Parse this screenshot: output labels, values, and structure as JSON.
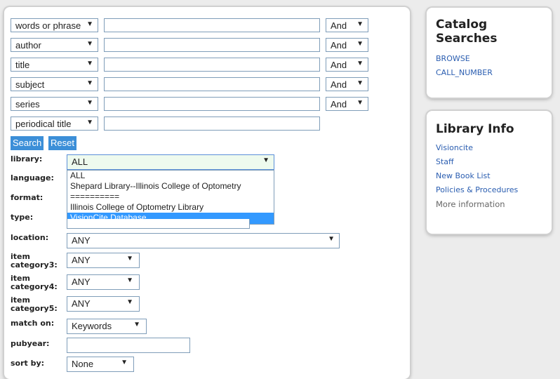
{
  "search_rows": [
    {
      "field": "words or phrase",
      "op": "And"
    },
    {
      "field": "author",
      "op": "And"
    },
    {
      "field": "title",
      "op": "And"
    },
    {
      "field": "subject",
      "op": "And"
    },
    {
      "field": "series",
      "op": "And"
    },
    {
      "field": "periodical title",
      "op": ""
    }
  ],
  "buttons": {
    "search": "Search",
    "reset": "Reset"
  },
  "filters": {
    "library": {
      "label": "library:",
      "value": "ALL"
    },
    "language": {
      "label": "language:"
    },
    "format": {
      "label": "format:"
    },
    "type": {
      "label": "type:"
    },
    "location": {
      "label": "location:",
      "value": "ANY"
    },
    "item_category3": {
      "label": "item category3:",
      "value": "ANY"
    },
    "item_category4": {
      "label": "item category4:",
      "value": "ANY"
    },
    "item_category5": {
      "label": "item category5:",
      "value": "ANY"
    },
    "match_on": {
      "label": "match on:",
      "value": "Keywords"
    },
    "pubyear": {
      "label": "pubyear:",
      "value": ""
    },
    "sort_by": {
      "label": "sort by:",
      "value": "None"
    }
  },
  "library_options": [
    "ALL",
    "Shepard Library--Illinois College of Optometry",
    "==========",
    "Illinois College of Optometry Library",
    "VisionCite Database"
  ],
  "library_highlighted": "VisionCite Database",
  "catalog_searches": {
    "title": "Catalog Searches",
    "links": [
      "BROWSE",
      "CALL_NUMBER"
    ]
  },
  "library_info": {
    "title": "Library Info",
    "links": [
      "Visioncite",
      "Staff",
      "New Book List",
      "Policies & Procedures"
    ],
    "more": "More information"
  },
  "colors": {
    "button_bg": "#3c8fd8",
    "link": "#2a5db0",
    "highlight": "#3399ff"
  }
}
